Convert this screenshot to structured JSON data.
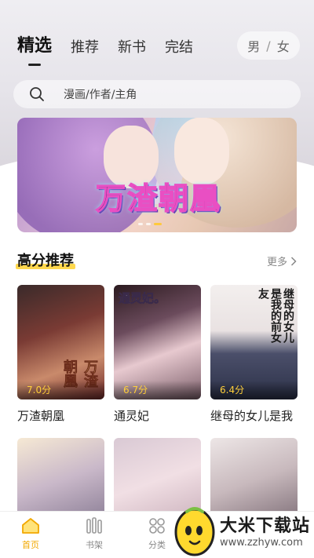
{
  "header": {
    "tabs": [
      {
        "label": "精选",
        "active": true
      },
      {
        "label": "推荐",
        "active": false
      },
      {
        "label": "新书",
        "active": false
      },
      {
        "label": "完结",
        "active": false
      }
    ],
    "gender": {
      "male": "男",
      "sep": "/",
      "female": "女"
    }
  },
  "search": {
    "placeholder": "漫画/作者/主角"
  },
  "banner": {
    "title": "万渣朝凰",
    "dots": 3,
    "active_dot": 2
  },
  "section": {
    "title": "高分推荐",
    "more": "更多",
    "items": [
      {
        "name": "万渣朝凰",
        "score": "7.0分",
        "cover_text": "万渣朝凰"
      },
      {
        "name": "通灵妃",
        "score": "6.7分",
        "cover_text": "通灵妃。"
      },
      {
        "name": "继母的女儿是我",
        "score": "6.4分",
        "cover_text": "继母的女儿是我的前女友"
      },
      {
        "name": "",
        "score": ""
      },
      {
        "name": "",
        "score": ""
      },
      {
        "name": "",
        "score": ""
      }
    ]
  },
  "bottom_nav": [
    {
      "label": "首页",
      "icon": "home-icon",
      "active": true
    },
    {
      "label": "书架",
      "icon": "bookshelf-icon",
      "active": false
    },
    {
      "label": "分类",
      "icon": "category-icon",
      "active": false
    }
  ],
  "watermark": {
    "name": "大米下载站",
    "url": "www.zzhyw.com"
  },
  "colors": {
    "accent": "#f2a800",
    "score": "#ffcf3a",
    "highlight": "#ffd84e"
  }
}
